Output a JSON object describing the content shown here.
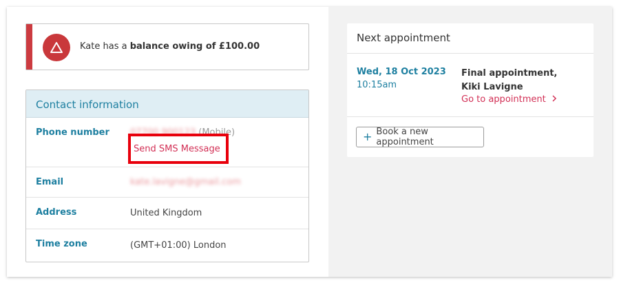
{
  "alert": {
    "prefix": "Kate has a",
    "emphasis": "balance owing of £100.00",
    "icon": "warning-triangle-icon",
    "color": "#cc3b40"
  },
  "contact": {
    "title": "Contact information",
    "phone_label": "Phone number",
    "phone_value": "07700 900123",
    "phone_type": "(Mobile)",
    "sms_link": "Send SMS Message",
    "email_label": "Email",
    "email_value": "kate.lavigne@gmail.com",
    "address_label": "Address",
    "address_value": "United Kingdom",
    "timezone_label": "Time zone",
    "timezone_value": "(GMT+01:00) London"
  },
  "appointment": {
    "title": "Next appointment",
    "date": "Wed, 18 Oct 2023",
    "time": "10:15am",
    "name": "Final appointment, Kiki Lavigne",
    "goto": "Go to appointment",
    "book_button": "Book a new appointment"
  },
  "colors": {
    "accent_blue": "#1d7fa0",
    "link_red": "#d22f55",
    "highlight": "#e8000c"
  }
}
